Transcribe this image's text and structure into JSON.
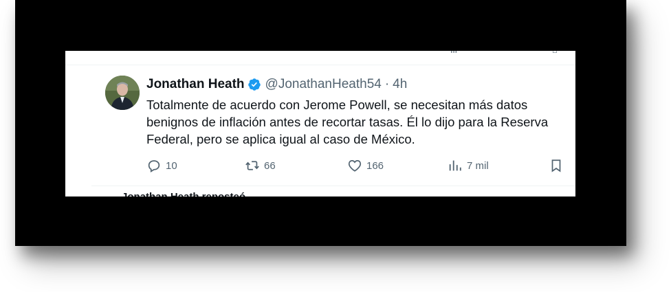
{
  "tweet": {
    "author_name": "Jonathan Heath",
    "handle": "@JonathanHeath54",
    "separator": "·",
    "time": "4h",
    "text_lines": [
      "Totalmente de acuerdo con Jerome Powell, se necesitan más datos",
      "benignos de inflación antes de recortar tasas. Él lo dijo para la Reserva",
      "Federal, pero se aplica igual al caso de México."
    ],
    "actions": {
      "replies": "10",
      "retweets": "66",
      "likes": "166",
      "views": "7 mil"
    }
  },
  "next_tweet_partial": "Jonathan Heath reposteó",
  "icons": {
    "verified": "verified-badge-icon",
    "reply": "reply-icon",
    "retweet": "retweet-icon",
    "like": "heart-icon",
    "views": "views-icon",
    "bookmark": "bookmark-icon"
  },
  "colors": {
    "verified_blue": "#1d9bf0",
    "text_primary": "#0f1419",
    "text_secondary": "#536471",
    "frame": "#000000"
  }
}
